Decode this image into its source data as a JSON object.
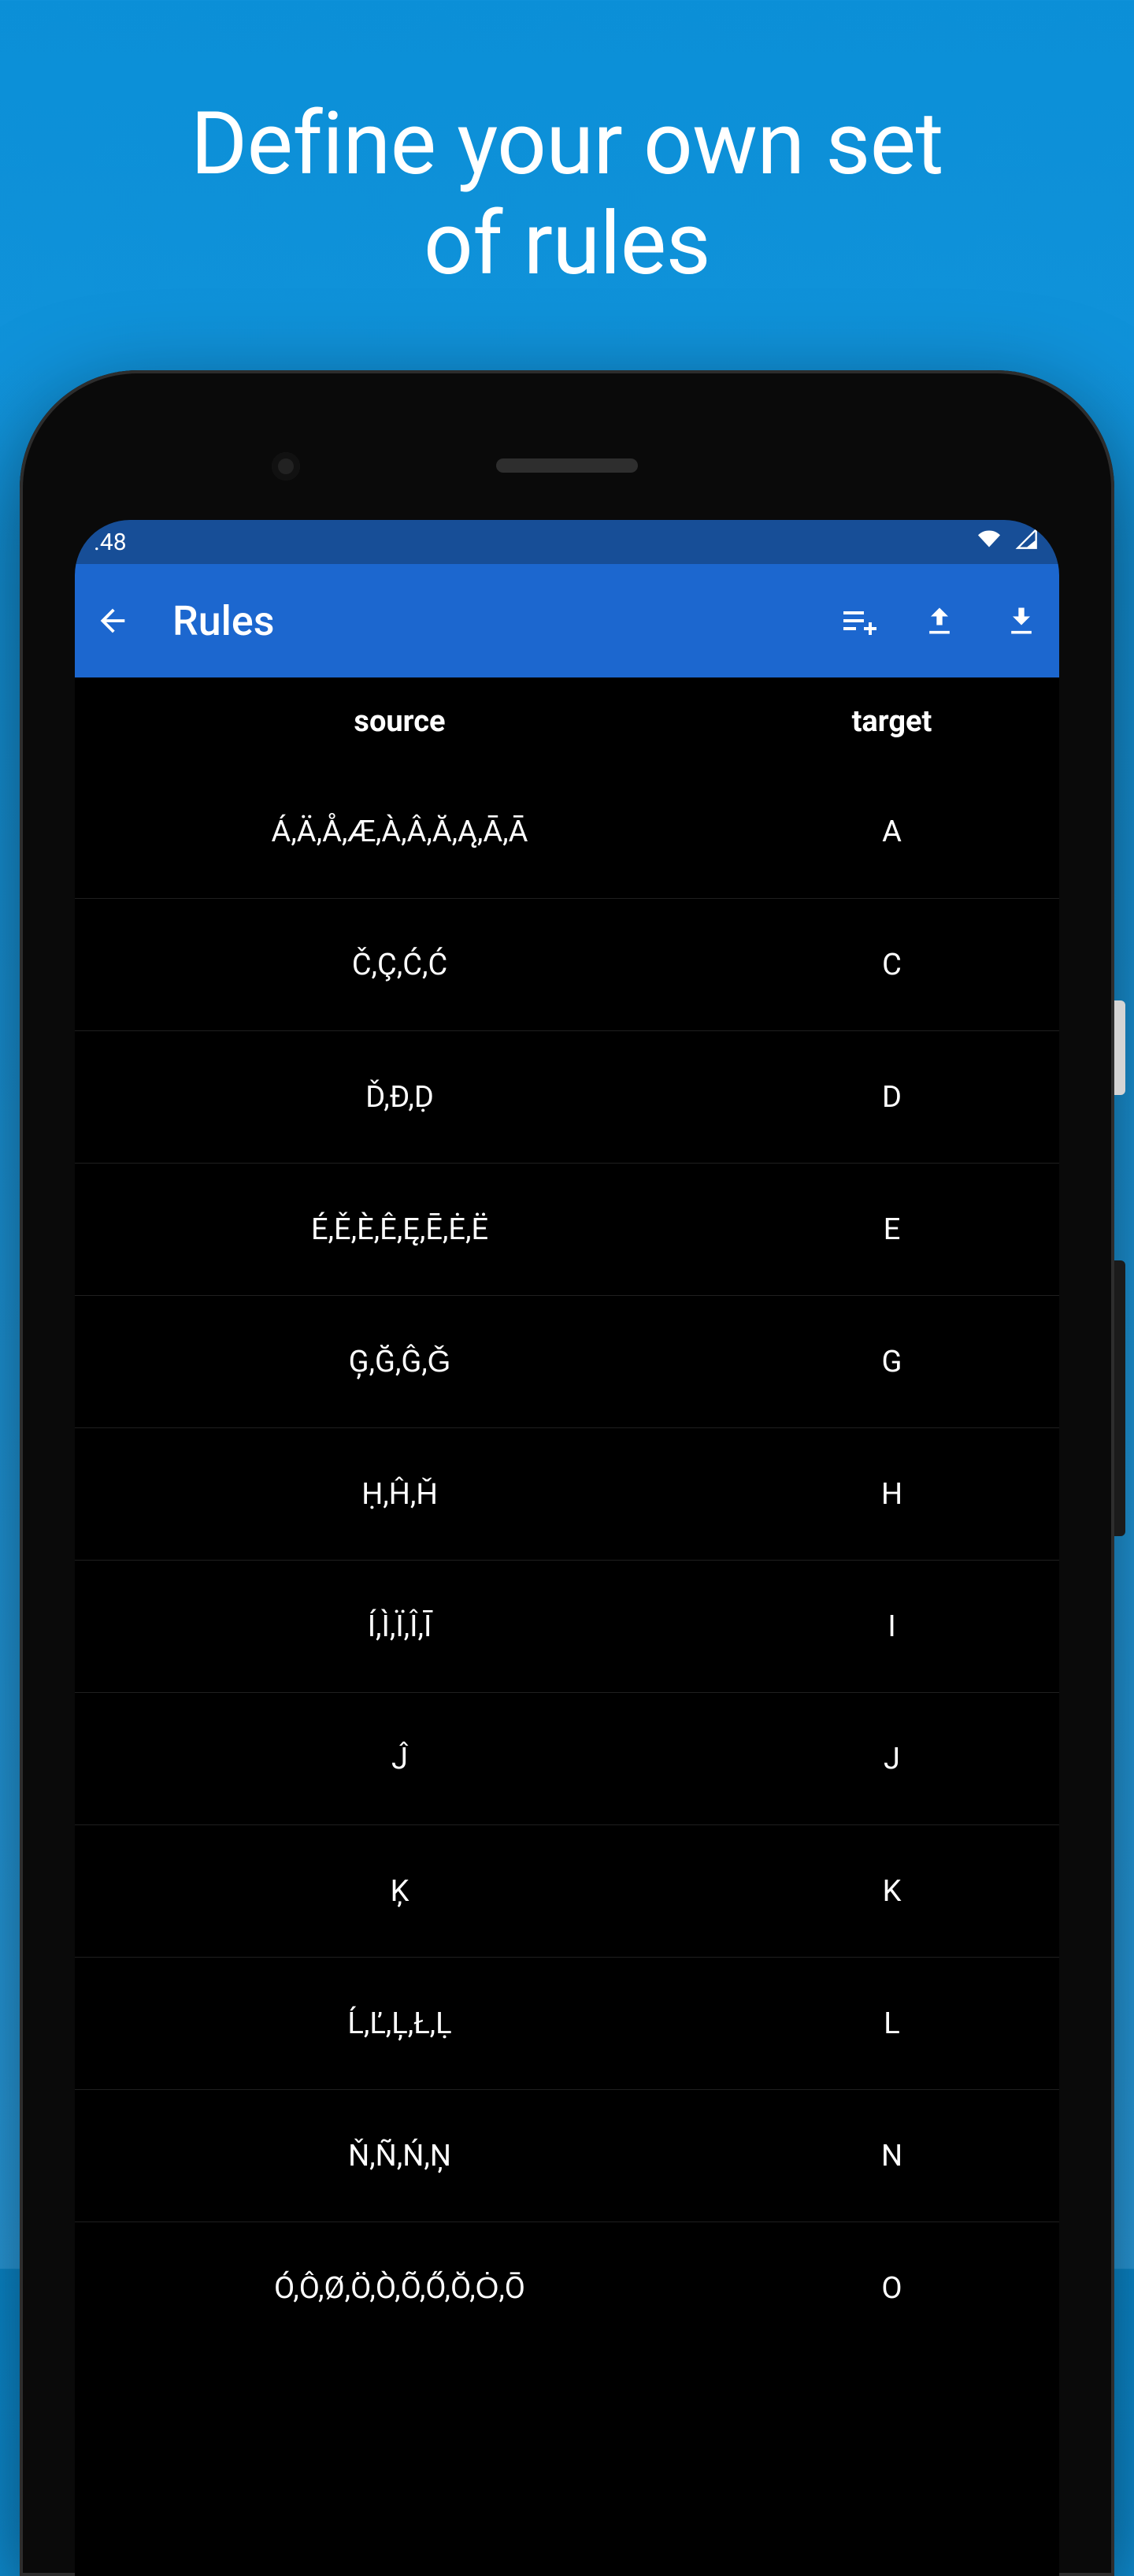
{
  "promo": {
    "title_line1": "Define your own set",
    "title_line2": "of rules"
  },
  "status_bar": {
    "time": ".48"
  },
  "app_bar": {
    "title": "Rules"
  },
  "rules": {
    "columns": {
      "source": "source",
      "target": "target"
    },
    "items": [
      {
        "source": "Á,Ä,Å,Æ,À,Â,Ă,Ą,Ā,Ā",
        "target": "A"
      },
      {
        "source": "Č,Ç,Ć,Ć",
        "target": "C"
      },
      {
        "source": "Ď,Đ,Ḍ",
        "target": "D"
      },
      {
        "source": "É,Ě,È,Ê,Ę,Ē,Ė,Ë",
        "target": "E"
      },
      {
        "source": "Ģ,Ğ,Ĝ,Ǧ",
        "target": "G"
      },
      {
        "source": "Ḥ,Ĥ,Ȟ",
        "target": "H"
      },
      {
        "source": "Í,Ì,Ï,Î,Ī",
        "target": "I"
      },
      {
        "source": "Ĵ",
        "target": "J"
      },
      {
        "source": "Ķ",
        "target": "K"
      },
      {
        "source": "Ĺ,Ľ,Ļ,Ł,Ḷ",
        "target": "L"
      },
      {
        "source": "Ň,Ñ,Ń,Ņ",
        "target": "N"
      },
      {
        "source": "Ó,Ô,Ø,Ö,Ò,Õ,Ő,Ŏ,Ȯ,Ō",
        "target": "O"
      }
    ]
  }
}
